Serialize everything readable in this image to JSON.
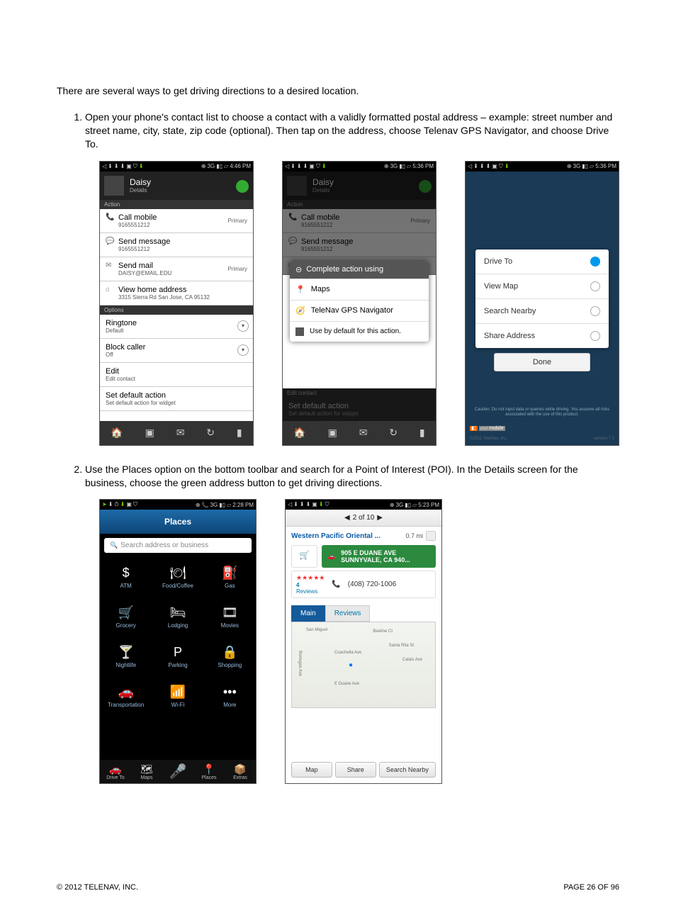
{
  "intro_text": "There are several ways to get driving directions to a desired location.",
  "steps": [
    "Open your phone's contact list to choose a contact with a validly formatted postal address – example: street number and street name, city, state, zip code (optional). Then tap on the address, choose Telenav GPS Navigator, and choose Drive To.",
    "Use the Places option on the bottom toolbar and search for a Point of Interest (POI). In the Details screen for the business, choose the green address button to get driving directions."
  ],
  "status_times": {
    "p1": "4:46 PM",
    "p2": "5:36 PM",
    "p3": "5:36 PM",
    "p4": "2:28 PM",
    "p5": "5:23 PM"
  },
  "status_net": "3G",
  "contact": {
    "name": "Daisy",
    "sub": "Details",
    "section_action": "Action",
    "section_options": "Options",
    "call": {
      "label": "Call mobile",
      "num": "9165551212",
      "tag": "Primary"
    },
    "msg": {
      "label": "Send message",
      "num": "9165551212"
    },
    "mail": {
      "label": "Send mail",
      "addr": "DAISY@EMAIL.EDU",
      "tag": "Primary"
    },
    "home": {
      "label": "View home address",
      "addr": "3315 Sierra Rd San Jose, CA 95132"
    },
    "ringtone": {
      "label": "Ringtone",
      "val": "Default"
    },
    "block": {
      "label": "Block caller",
      "val": "Off"
    },
    "edit": {
      "label": "Edit",
      "val": "Edit contact"
    },
    "defact": {
      "label": "Set default action",
      "val": "Set default action for widget"
    },
    "editcontact_head": "Edit contact"
  },
  "popup": {
    "title": "Complete action using",
    "opt1": "Maps",
    "opt2": "TeleNav GPS Navigator",
    "chk": "Use by default for this action."
  },
  "telenav": {
    "opts": [
      "Drive To",
      "View Map",
      "Search Nearby",
      "Share Address"
    ],
    "done": "Done",
    "caution": "Caution: Do not input data or queries while driving. You assume all risks associated with the use of this product.",
    "copyright": "©2011 TeleNav, Inc.",
    "version": "version 7.0"
  },
  "places": {
    "title": "Places",
    "search_ph": "Search address or business",
    "tiles": [
      {
        "ic": "$",
        "label": "ATM"
      },
      {
        "ic": "🍽",
        "label": "Food/Coffee"
      },
      {
        "ic": "⛽",
        "label": "Gas"
      },
      {
        "ic": "🛒",
        "label": "Grocery"
      },
      {
        "ic": "🛏",
        "label": "Lodging"
      },
      {
        "ic": "🎞",
        "label": "Movies"
      },
      {
        "ic": "🍸",
        "label": "Nightlife"
      },
      {
        "ic": "P",
        "label": "Parking"
      },
      {
        "ic": "🔒",
        "label": "Shopping"
      },
      {
        "ic": "🚗",
        "label": "Transportation"
      },
      {
        "ic": "📶",
        "label": "Wi-Fi"
      },
      {
        "ic": "•••",
        "label": "More"
      }
    ],
    "nav": [
      {
        "ic": "🚗",
        "label": "Drive To"
      },
      {
        "ic": "🗺",
        "label": "Maps"
      },
      {
        "ic": "🎤",
        "label": ""
      },
      {
        "ic": "📍",
        "label": "Places"
      },
      {
        "ic": "📦",
        "label": "Extras"
      }
    ]
  },
  "details": {
    "pager": "2 of 10",
    "name": "Western Pacific Oriental ...",
    "dist": "0.7 mi",
    "addr_line1": "905 E DUANE AVE",
    "addr_line2": "SUNNYVALE, CA 940...",
    "reviews_count": "4",
    "reviews_label": "Reviews",
    "stars": "★★★★★",
    "phone": "(408) 720-1006",
    "tab_main": "Main",
    "tab_rev": "Reviews",
    "streets": [
      "San Miguel",
      "Coachella Ave",
      "Santa Rita St",
      "Calais Ave",
      "E Duane Ave",
      "Borregas Ave",
      "Beeline Ct"
    ],
    "btns": [
      "Map",
      "Share",
      "Search Nearby"
    ]
  },
  "footer": {
    "left": "© 2012 TELENAV, INC.",
    "right": "PAGE 26 OF 96"
  }
}
